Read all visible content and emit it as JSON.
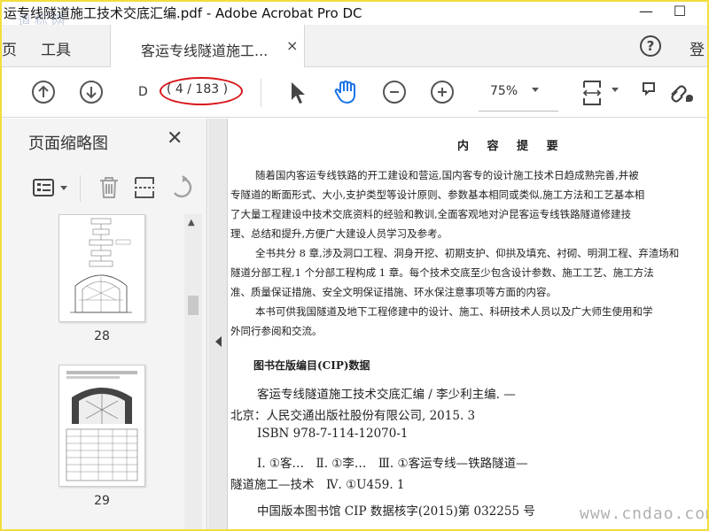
{
  "window": {
    "title": "运专线隧道施工技术交底汇编.pdf - Adobe Acrobat Pro DC",
    "minimize": "—",
    "maximize": "☐",
    "watermark_top": "道标网"
  },
  "tabs": {
    "partial_left": "页",
    "tools": "工具",
    "document": "客运专线隧道施工...",
    "close": "×",
    "help": "?",
    "sign_partial": "登"
  },
  "toolbar": {
    "page_field": "D",
    "page_indicator": "( 4 / 183 )",
    "zoom": "75%",
    "highlight_color": "#d8161b",
    "hand_color": "#1a73e8"
  },
  "sidebar": {
    "title": "页面缩略图",
    "close": "✕",
    "thumbnails": [
      {
        "number": "28"
      },
      {
        "number": "29"
      }
    ]
  },
  "document": {
    "heading": "内 容 提 要",
    "paragraphs": [
      "随着国内客运专线铁路的开工建设和营运,国内客专的设计施工技术日趋成熟完善,并被",
      "专隧道的断面形式、大小,支护类型等设计原则、参数基本相同或类似,施工方法和工艺基本相",
      "了大量工程建设中技术交底资料的经验和教训,全面客观地对沪昆客运专线铁路隧道修建技",
      "理、总结和提升,方便广大建设人员学习及参考。",
      "全书共分 8 章,涉及洞口工程、洞身开挖、初期支护、仰拱及填充、衬砌、明洞工程、弃渣场和",
      "隧道分部工程,1 个分部工程构成 1 章。每个技术交底至少包含设计参数、施工工艺、施工方法",
      "准、质量保证措施、安全文明保证措施、环水保注意事项等方面的内容。",
      "本书可供我国隧道及地下工程修建中的设计、施工、科研技术人员以及广大师生使用和学",
      "外同行参阅和交流。"
    ],
    "cip_heading": "图书在版编目(CIP)数据",
    "cip_lines": [
      "客运专线隧道施工技术交底汇编 / 李少利主编. —",
      "北京：人民交通出版社股份有限公司, 2015. 3",
      "ISBN 978-7-114-12070-1",
      "Ⅰ. ①客…　Ⅱ. ①李…　Ⅲ. ①客运专线—铁路隧道—",
      "隧道施工—技术　Ⅳ. ①U459. 1",
      "中国版本图书馆 CIP 数据核字(2015)第 032255 号"
    ]
  },
  "watermark": "www.cndao.com"
}
